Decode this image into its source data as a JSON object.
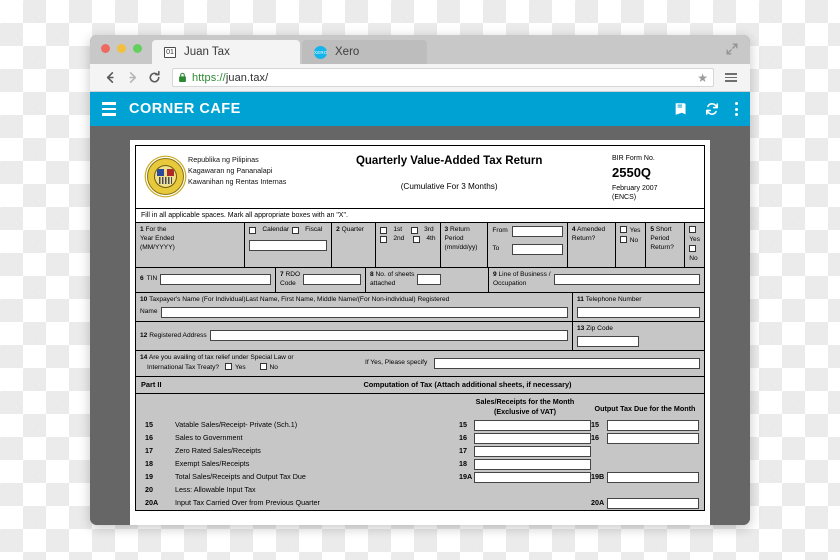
{
  "browser": {
    "tabs": [
      {
        "title": "Juan Tax",
        "favicon": "numbered-box-01-icon",
        "favicon_text": "01",
        "active": true
      },
      {
        "title": "Xero",
        "favicon": "xero-circle-icon",
        "favicon_text": "XERO",
        "active": false
      }
    ],
    "window_controls": [
      "close-red",
      "minimize-yellow",
      "maximize-green"
    ],
    "expand_icon": "expand-arrows-icon",
    "back_icon": "arrow-left-icon",
    "forward_icon": "arrow-right-icon",
    "reload_icon": "reload-icon",
    "lock_icon": "padlock-icon",
    "url_scheme": "https://",
    "url_host": "juan.tax/",
    "star_icon": "★",
    "menu_icon": "hamburger-menu-icon"
  },
  "appbar": {
    "menu_icon": "hamburger-menu-icon",
    "title": "CORNER CAFE",
    "actions": [
      "book-icon",
      "refresh-sync-icon",
      "overflow-dots-icon"
    ],
    "color": "#00a2d4"
  },
  "form": {
    "agency_lines": [
      "Republika ng Pilipinas",
      "Kagawaran ng Pananalapi",
      "Kawanihan ng Rentas Internas"
    ],
    "title": "Quarterly Value-Added Tax Return",
    "subtitle": "(Cumulative For 3 Months)",
    "bir_label": "BIR Form No.",
    "bir_number": "2550Q",
    "bir_date": "February 2007",
    "bir_encs": "(ENCS)",
    "instruction": "Fill in all applicable spaces. Mark all appropriate boxes with an \"X\".",
    "f1": {
      "num": "1",
      "l1": "For the",
      "l2": "Year Ended",
      "l3": "(MM/YYYY)",
      "opt1": "Calendar",
      "opt2": "Fiscal",
      "value": ""
    },
    "f2": {
      "num": "2",
      "label": "Quarter",
      "opts": [
        "1st",
        "3rd",
        "2nd",
        "4th"
      ]
    },
    "f3": {
      "num": "3",
      "l1": "Return",
      "l2": "Period",
      "l3": "(mm/dd/yy)",
      "from": "From",
      "to": "To",
      "from_value": "",
      "to_value": ""
    },
    "f4": {
      "num": "4",
      "l1": "Amended",
      "l2": "Return?",
      "yes": "Yes",
      "no": "No"
    },
    "f5": {
      "num": "5",
      "l1": "Short",
      "l2": "Period",
      "l3": "Return?",
      "yes": "Yes",
      "no": "No"
    },
    "f6": {
      "num": "6",
      "label": "TIN",
      "value": ""
    },
    "f7": {
      "num": "7",
      "l1": "RDO",
      "l2": "Code",
      "value": ""
    },
    "f8": {
      "num": "8",
      "l1": "No. of sheets",
      "l2": "attached",
      "value": ""
    },
    "f9": {
      "num": "9",
      "l1": "Line of Business /",
      "l2": "Occupation",
      "value": ""
    },
    "f10": {
      "num": "10",
      "label": "Taxpayer's Name (For Individual)Last Name, First Name, Middle Name/(For Non-individual) Registered",
      "label2": "Name",
      "value": ""
    },
    "f11": {
      "num": "11",
      "label": "Telephone Number",
      "value": ""
    },
    "f12": {
      "num": "12",
      "label": "Registered Address",
      "value": ""
    },
    "f13": {
      "num": "13",
      "label": "Zip Code",
      "value": ""
    },
    "f14": {
      "num": "14",
      "l1": "Are you availing of tax relief under Special Law or",
      "l2": "International Tax Treaty?",
      "yes": "Yes",
      "no": "No",
      "specify_label": "If Yes, Please specify",
      "specify_value": ""
    },
    "part2": {
      "label": "Part II",
      "title": "Computation of Tax (Attach additional sheets, if necessary)"
    },
    "col_sales_l1": "Sales/Receipts for the Month",
    "col_sales_l2": "(Exclusive of VAT)",
    "col_output": "Output Tax Due for the Month",
    "rows": [
      {
        "no": "15",
        "desc": "Vatable Sales/Receipt- Private (Sch.1)",
        "k1": "15",
        "k2": "15",
        "f1": true,
        "f2": true
      },
      {
        "no": "16",
        "desc": "Sales to Government",
        "k1": "16",
        "k2": "16",
        "f1": true,
        "f2": true
      },
      {
        "no": "17",
        "desc": "Zero Rated Sales/Receipts",
        "k1": "17",
        "k2": "",
        "f1": true,
        "f2": false
      },
      {
        "no": "18",
        "desc": "Exempt Sales/Receipts",
        "k1": "18",
        "k2": "",
        "f1": true,
        "f2": false
      },
      {
        "no": "19",
        "desc": "Total Sales/Receipts and Output Tax Due",
        "k1": "19A",
        "k2": "19B",
        "f1": true,
        "f2": true
      },
      {
        "no": "20",
        "desc": "Less: Allowable Input Tax",
        "k1": "",
        "k2": "",
        "f1": false,
        "f2": false
      },
      {
        "no": "20A",
        "desc": "Input Tax Carried Over from Previous Quarter",
        "k1": "",
        "k2": "20A",
        "f1": false,
        "f2": true
      }
    ]
  }
}
